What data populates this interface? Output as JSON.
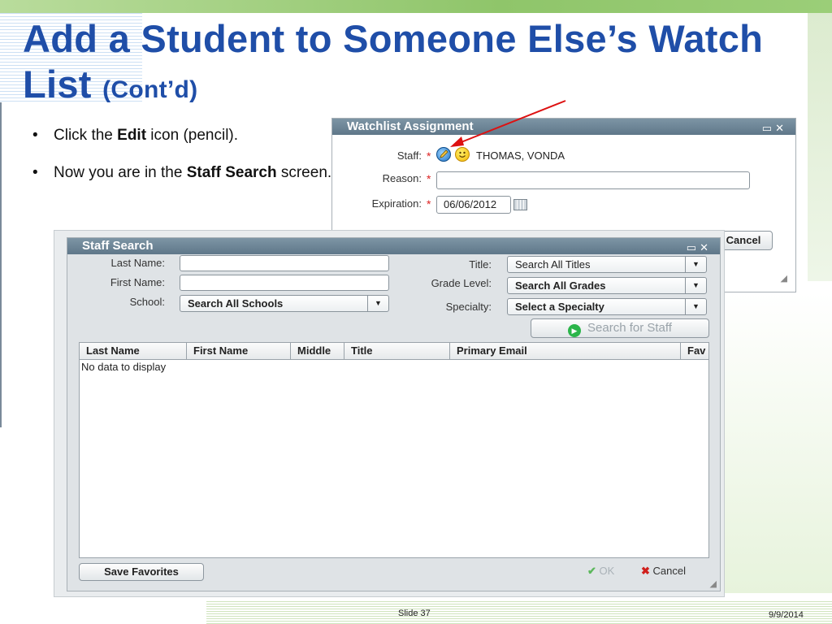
{
  "slide": {
    "title_main": "Add a Student to Someone Else’s Watch List",
    "title_suffix": "(Cont’d)",
    "bullets": [
      {
        "pre": "Click the ",
        "bold": "Edit",
        "post": " icon (pencil)."
      },
      {
        "pre": "Now you are in the ",
        "bold": "Staff Search",
        "post": " screen."
      }
    ],
    "footer_slide": "Slide 37",
    "footer_date": "9/9/2014"
  },
  "watchlist": {
    "title": "Watchlist Assignment",
    "staff_label": "Staff:",
    "staff_value": "THOMAS, VONDA",
    "reason_label": "Reason:",
    "reason_value": "",
    "expiration_label": "Expiration:",
    "expiration_value": "06/06/2012",
    "cancel_label": "Cancel",
    "required_mark": "*"
  },
  "staff_search": {
    "title": "Staff Search",
    "last_name_label": "Last Name:",
    "first_name_label": "First Name:",
    "school_label": "School:",
    "school_value": "Search All Schools",
    "title_label": "Title:",
    "title_value": "Search All Titles",
    "grade_label": "Grade Level:",
    "grade_value": "Search All Grades",
    "specialty_label": "Specialty:",
    "specialty_value": "Select a Specialty",
    "search_button": "Search for Staff",
    "columns": [
      "Last Name",
      "First Name",
      "Middle",
      "Title",
      "Primary Email",
      "Fav"
    ],
    "empty_text": "No data to display",
    "save_favorites": "Save Favorites",
    "ok_label": "OK",
    "cancel_label": "Cancel"
  },
  "colors": {
    "title_blue": "#1f4ea8",
    "window_header": "#6b8294",
    "required_red": "#dd2222",
    "arrow_red": "#dd1111"
  }
}
